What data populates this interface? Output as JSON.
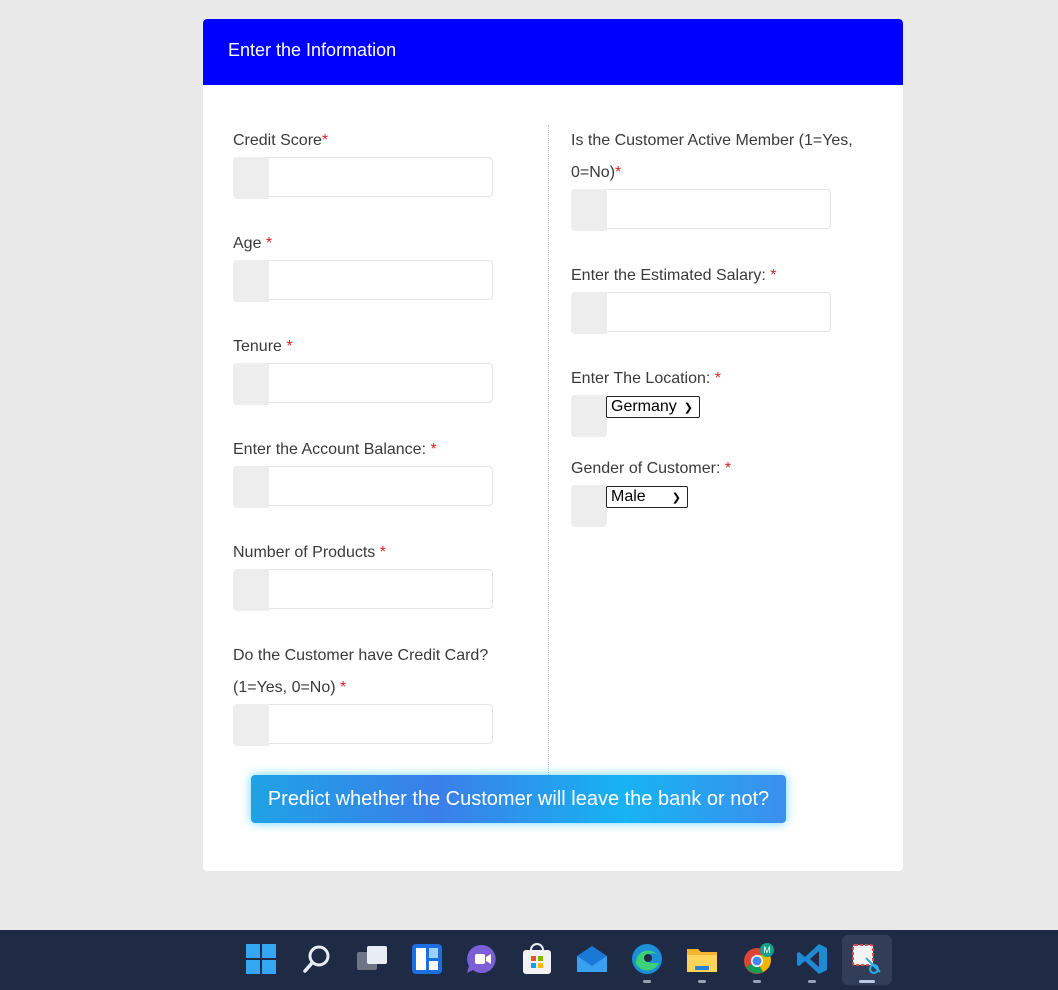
{
  "form": {
    "title": "Enter the Information",
    "required_mark": "*",
    "labels": {
      "credit_score": "Credit Score",
      "age": "Age ",
      "tenure": "Tenure ",
      "account_balance": "Enter the Account Balance: ",
      "num_products": "Number of Products ",
      "has_credit_card_line1": "Do the Customer have Credit Card?",
      "has_credit_card_line2": "(1=Yes, 0=No) ",
      "active_member_line1": "Is the Customer Active Member (1=Yes,",
      "active_member_line2": "0=No)",
      "estimated_salary": "Enter the Estimated Salary: ",
      "location": "Enter The Location: ",
      "gender": "Gender of Customer: "
    },
    "inputs": {
      "credit_score": "",
      "age": "",
      "tenure": "",
      "account_balance": "",
      "num_products": "",
      "has_credit_card": "",
      "active_member": "",
      "estimated_salary": ""
    },
    "location_selected": "Germany",
    "gender_selected": "Male",
    "submit_label": "Predict whether the Customer will leave the bank or not?"
  },
  "colors": {
    "header_bg": "#0000ff",
    "required": "#e02020",
    "taskbar": "#1f2a44"
  },
  "taskbar": {
    "icons": [
      "windows-start-icon",
      "search-icon",
      "task-view-icon",
      "widgets-icon",
      "teams-chat-icon",
      "microsoft-store-icon",
      "mail-icon",
      "edge-icon",
      "file-explorer-icon",
      "chrome-icon",
      "vscode-icon",
      "snipping-tool-icon"
    ],
    "chrome_badge": "M"
  }
}
